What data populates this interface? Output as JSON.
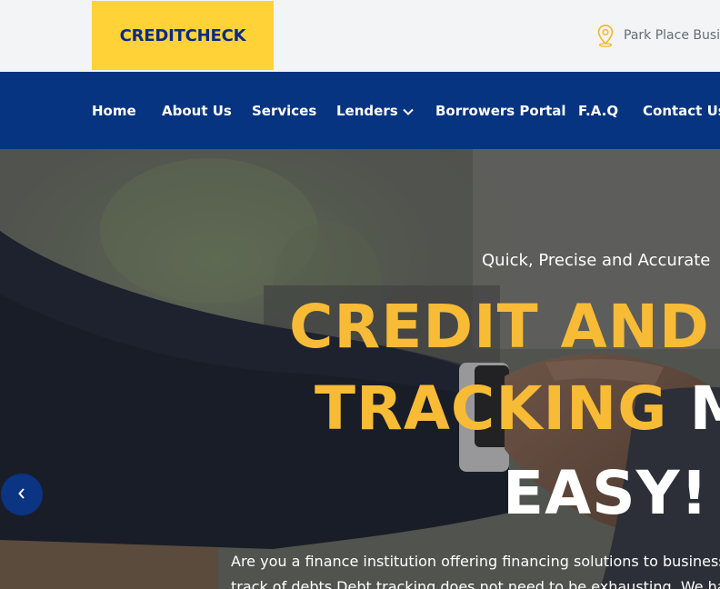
{
  "brand": {
    "logo_text": "CREDITCHECK",
    "logo_bg": "#ffd238",
    "logo_text_color": "#0a2a86"
  },
  "topbar": {
    "address_icon": "map-pin-icon",
    "address_text": "Park Place Business"
  },
  "nav": {
    "items": [
      {
        "label": "Home"
      },
      {
        "label": "About Us"
      },
      {
        "label": "Services"
      },
      {
        "label": "Lenders",
        "has_dropdown": true,
        "dropdown_icon": "chevron-down-icon"
      },
      {
        "label": "Borrowers Portal"
      },
      {
        "label": "F.A.Q"
      },
      {
        "label": "Contact Us"
      }
    ],
    "background": "#063480"
  },
  "hero": {
    "subtitle": "Quick, Precise and Accurate",
    "headline_line1": "CREDIT AND",
    "headline_line2_accent": "TRACKING",
    "headline_line2_rest": "M",
    "headline_line3": "EASY!",
    "description_line1": "Are you a finance institution offering financing solutions to businesses or",
    "description_line2": "track of debts Debt tracking does not need to be exhausting. We have the",
    "accent_color": "#f8bb36",
    "prev_icon": "chevron-left-icon"
  }
}
